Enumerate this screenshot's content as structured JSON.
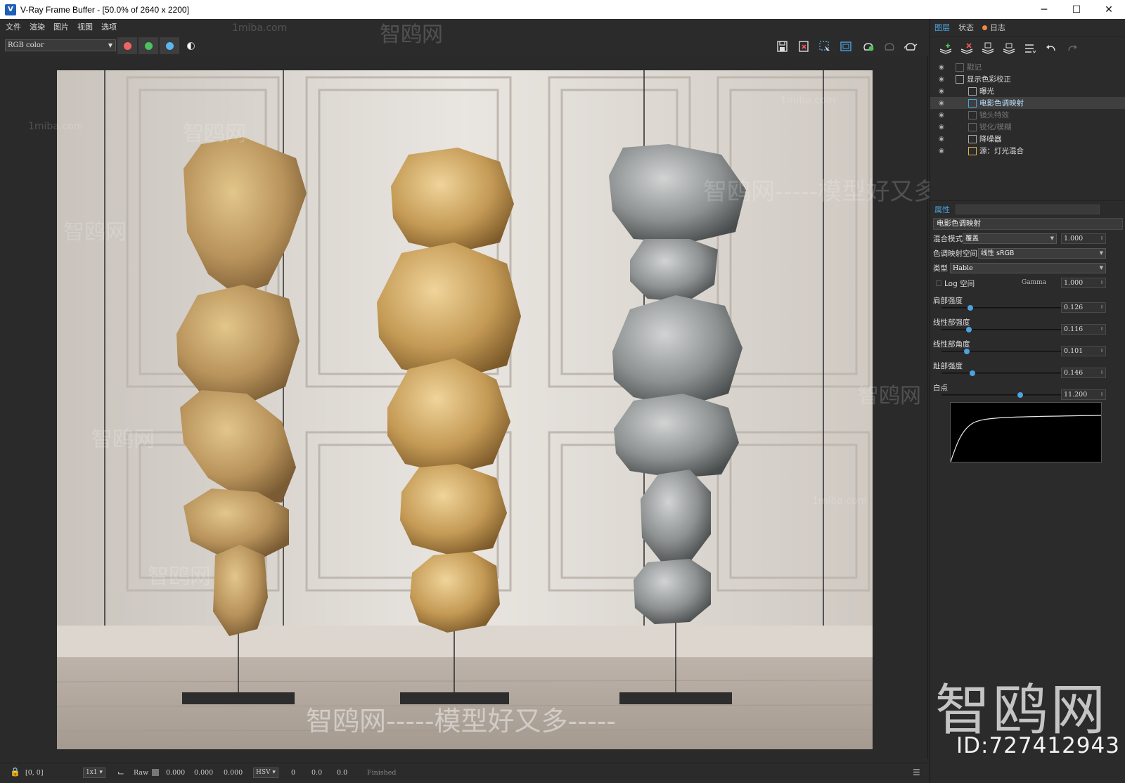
{
  "window": {
    "title": "V-Ray Frame Buffer - [50.0% of 2640 x 2200]",
    "minimize": "─",
    "maximize": "☐",
    "close": "✕"
  },
  "menu": [
    "文件",
    "渲染",
    "图片",
    "视图",
    "选项"
  ],
  "toolbar": {
    "channel": "RGB color",
    "channel_colors": {
      "red": "#f06464",
      "green": "#4cc25b",
      "blue": "#5bb7ee"
    }
  },
  "panel": {
    "tabs": [
      "图层",
      "状态",
      "日志"
    ],
    "layers": [
      {
        "name": "戳记",
        "visible": false
      },
      {
        "name": "显示色彩校正",
        "visible": true
      },
      {
        "name": "曝光",
        "visible": true
      },
      {
        "name": "电影色调映射",
        "visible": true
      },
      {
        "name": "镜头特效",
        "visible": false
      },
      {
        "name": "锐化/模糊",
        "visible": false
      },
      {
        "name": "降噪器",
        "visible": true
      },
      {
        "name": "源：灯光混合",
        "visible": true
      }
    ],
    "properties_label": "属性",
    "properties_title": "电影色调映射",
    "blend_mode_label": "混合模式",
    "blend_mode_value": "覆盖",
    "blend_amount": "1.000",
    "tonemap_space_label": "色调映射空间",
    "tonemap_space_value": "线性 sRGB",
    "type_label": "类型",
    "type_value": "Hable",
    "log_space_label": "Log 空间",
    "gamma_label": "Gamma",
    "gamma_value": "1.000",
    "sliders": [
      {
        "label": "肩部强度",
        "value": "0.126",
        "fraction": 0.126
      },
      {
        "label": "线性部强度",
        "value": "0.116",
        "fraction": 0.116
      },
      {
        "label": "线性部角度",
        "value": "0.101",
        "fraction": 0.101
      },
      {
        "label": "趾部强度",
        "value": "0.146",
        "fraction": 0.146
      },
      {
        "label": "白点",
        "value": "11.200",
        "fraction": 0.52
      }
    ]
  },
  "status": {
    "coords": "[0, 0]",
    "zoom": "1x1",
    "raw_label": "Raw",
    "r": "0.000",
    "g": "0.000",
    "b": "0.000",
    "color_space": "HSV",
    "h": "0",
    "s": "0.0",
    "v": "0.0",
    "state": "Finished"
  },
  "watermarks": {
    "big": "智鸥网",
    "id": "ID:727412943",
    "site": "1miba.com",
    "cn_main": "智鸥网",
    "cn_slogan": "智鸥网-----模型好又多-----"
  }
}
